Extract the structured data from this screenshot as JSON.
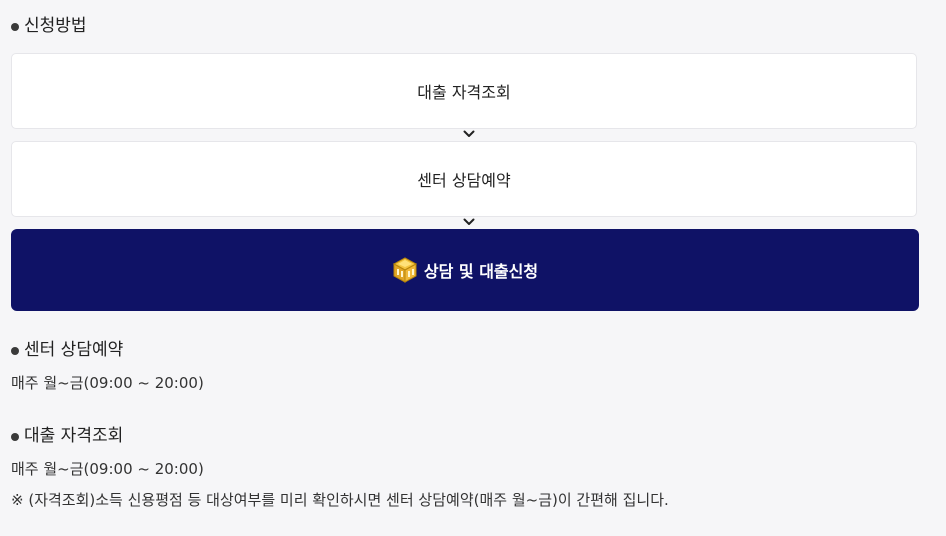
{
  "method": {
    "title": "신청방법",
    "steps": [
      {
        "label": "대출 자격조회"
      },
      {
        "label": "센터 상담예약"
      }
    ],
    "cta_label": "상담 및 대출신청",
    "cta_icon": "building-icon"
  },
  "center_reservation": {
    "title": "센터 상담예약",
    "hours": "매주 월~금(09:00 ~ 20:00)"
  },
  "loan_eligibility": {
    "title": "대출 자격조회",
    "hours": "매주 월~금(09:00 ~ 20:00)",
    "note": "※ (자격조회)소득 신용평점 등 대상여부를 미리 확인하시면 센터 상담예약(매주 월~금)이 간편해 집니다."
  },
  "colors": {
    "background": "#f6f6f8",
    "cta": "#0f1266",
    "box": "#ffffff"
  }
}
